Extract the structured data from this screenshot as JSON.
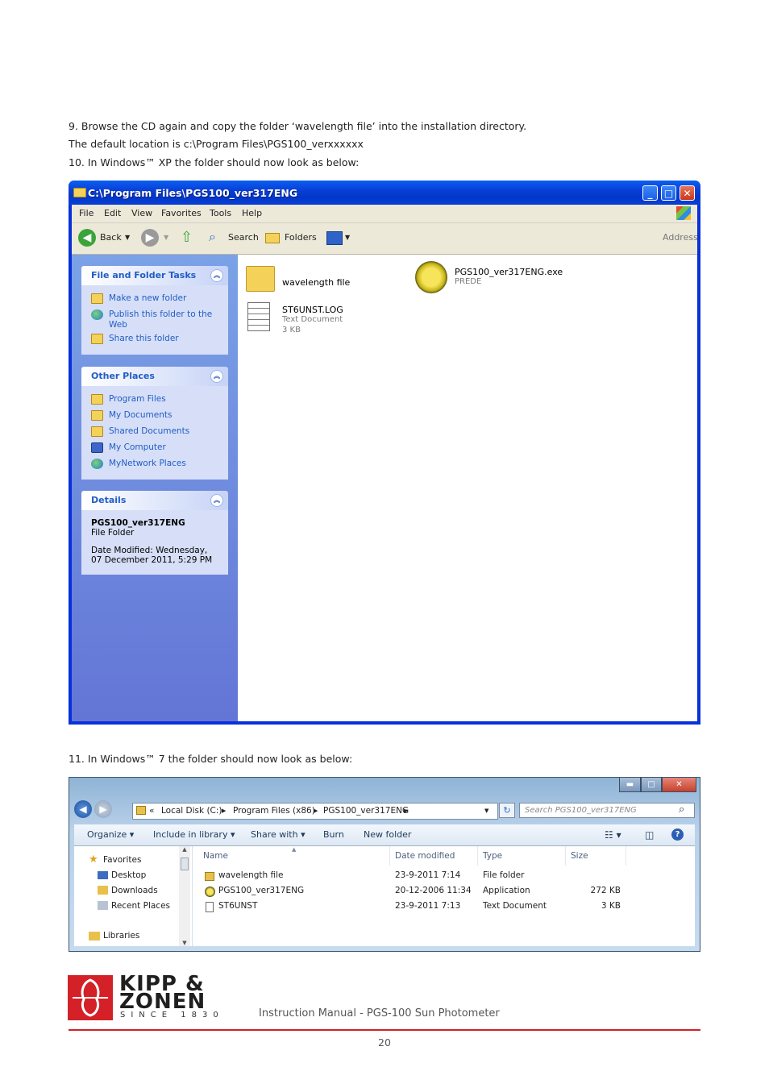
{
  "instructions": {
    "step9a": "9. Browse the CD again and copy the folder ‘wavelength file’ into the installation directory.",
    "step9b": "The default location is c:\\Program Files\\PGS100_verxxxxxx",
    "step10": "10. In Windows™ XP the folder should now look as below:",
    "step11": "11. In Windows™ 7 the folder should now look as below:"
  },
  "xp_window": {
    "title": "C:\\Program Files\\PGS100_ver317ENG",
    "menu": [
      "File",
      "Edit",
      "View",
      "Favorites",
      "Tools",
      "Help"
    ],
    "toolbar": {
      "back": "Back",
      "search": "Search",
      "folders": "Folders",
      "address": "Address"
    },
    "file_tasks": {
      "title": "File and Folder Tasks",
      "items": [
        "Make a new folder",
        "Publish this folder to the Web",
        "Share this folder"
      ]
    },
    "other_places": {
      "title": "Other Places",
      "items": [
        "Program Files",
        "My Documents",
        "Shared Documents",
        "My Computer",
        "MyNetwork Places"
      ]
    },
    "details": {
      "title": "Details",
      "name": "PGS100_ver317ENG",
      "type": "File Folder",
      "modified": "Date Modified: Wednesday, 07 December 2011, 5:29 PM"
    },
    "files": [
      {
        "name": "wavelength file",
        "line2": "",
        "line3": ""
      },
      {
        "name": "PGS100_ver317ENG.exe",
        "line2": "PREDE",
        "line3": ""
      },
      {
        "name": "ST6UNST.LOG",
        "line2": "Text Document",
        "line3": "3 KB"
      }
    ]
  },
  "w7_window": {
    "breadcrumb": [
      "«",
      "Local Disk (C:)",
      "Program Files (x86)",
      "PGS100_ver317ENG"
    ],
    "search_placeholder": "Search PGS100_ver317ENG",
    "commands": [
      "Organize ▾",
      "Include in library ▾",
      "Share with ▾",
      "Burn",
      "New folder"
    ],
    "nav": {
      "favorites": "Favorites",
      "items": [
        "Desktop",
        "Downloads",
        "Recent Places"
      ],
      "libraries": "Libraries"
    },
    "columns": [
      "Name",
      "Date modified",
      "Type",
      "Size"
    ],
    "rows": [
      {
        "name": "wavelength file",
        "date": "23-9-2011 7:14",
        "type": "File folder",
        "size": ""
      },
      {
        "name": "PGS100_ver317ENG",
        "date": "20-12-2006 11:34",
        "type": "Application",
        "size": "272 KB"
      },
      {
        "name": "ST6UNST",
        "date": "23-9-2011 7:13",
        "type": "Text Document",
        "size": "3 KB"
      }
    ]
  },
  "footer": {
    "logo_line1": "KIPP &",
    "logo_line2": "ZONEN",
    "logo_since": "SINCE 1830",
    "manual_title": "Instruction Manual - PGS-100 Sun Photometer",
    "page": "20"
  }
}
